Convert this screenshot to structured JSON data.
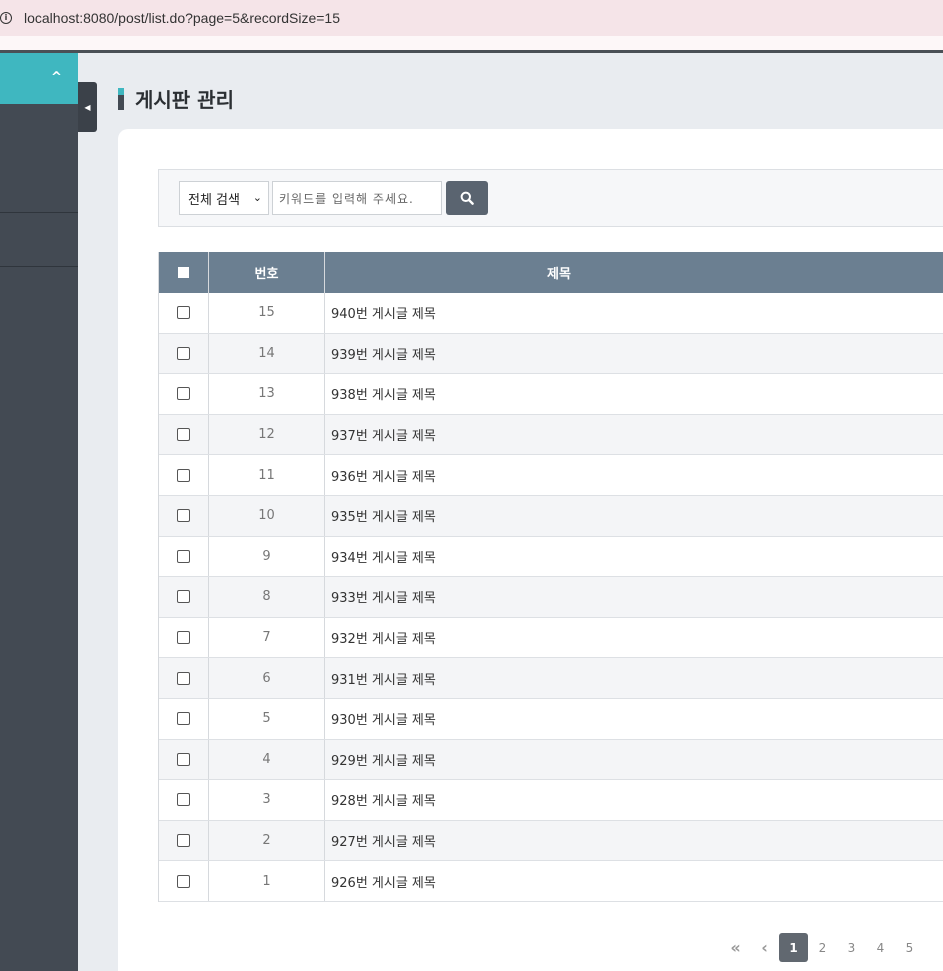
{
  "browser": {
    "url": "localhost:8080/post/list.do?page=5&recordSize=15"
  },
  "sidebar": {
    "collapse_icon": "chevron-up-icon",
    "toggle_icon": "caret-left-icon"
  },
  "page": {
    "title": "게시판 관리"
  },
  "search": {
    "select_value": "전체 검색",
    "placeholder": "키워드를 입력해 주세요.",
    "button_icon": "search-icon"
  },
  "table": {
    "columns": [
      "번호",
      "제목"
    ],
    "rows": [
      {
        "num": "15",
        "title": "940번 게시글 제목"
      },
      {
        "num": "14",
        "title": "939번 게시글 제목"
      },
      {
        "num": "13",
        "title": "938번 게시글 제목"
      },
      {
        "num": "12",
        "title": "937번 게시글 제목"
      },
      {
        "num": "11",
        "title": "936번 게시글 제목"
      },
      {
        "num": "10",
        "title": "935번 게시글 제목"
      },
      {
        "num": "9",
        "title": "934번 게시글 제목"
      },
      {
        "num": "8",
        "title": "933번 게시글 제목"
      },
      {
        "num": "7",
        "title": "932번 게시글 제목"
      },
      {
        "num": "6",
        "title": "931번 게시글 제목"
      },
      {
        "num": "5",
        "title": "930번 게시글 제목"
      },
      {
        "num": "4",
        "title": "929번 게시글 제목"
      },
      {
        "num": "3",
        "title": "928번 게시글 제목"
      },
      {
        "num": "2",
        "title": "927번 게시글 제목"
      },
      {
        "num": "1",
        "title": "926번 게시글 제목"
      }
    ]
  },
  "pagination": {
    "first_label": "«",
    "prev_label": "‹",
    "pages": [
      "1",
      "2",
      "3",
      "4",
      "5"
    ],
    "active": "1"
  },
  "colors": {
    "accent": "#3fb7c0",
    "sidebar": "#434a53",
    "table_header": "#6b7f91"
  }
}
